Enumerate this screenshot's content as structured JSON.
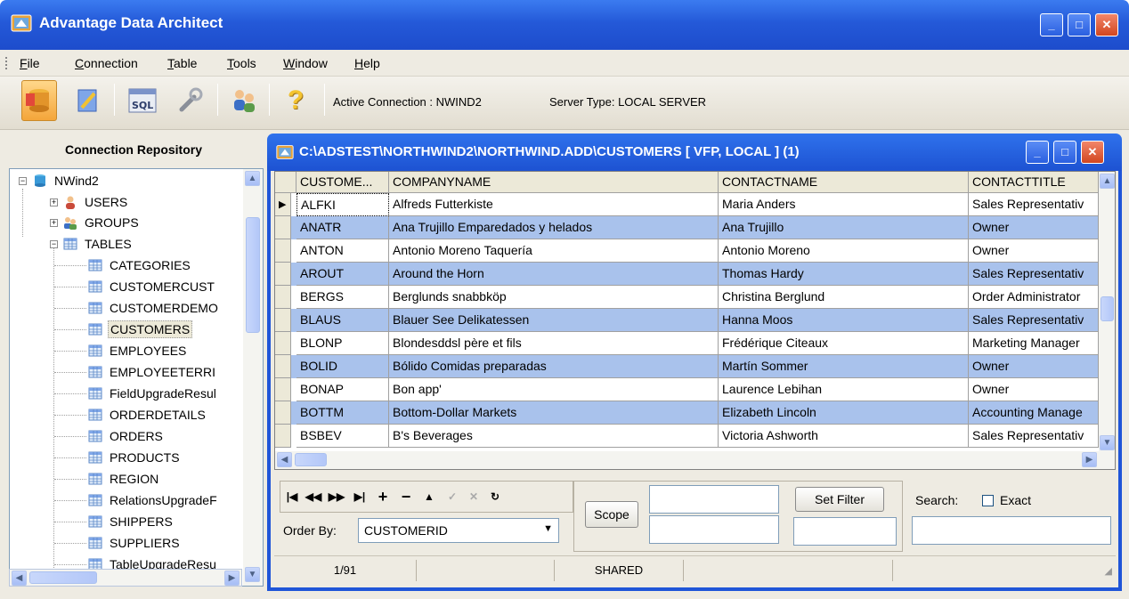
{
  "window": {
    "title": "Advantage Data Architect",
    "minimize": "_",
    "maximize": "□",
    "close": "✕"
  },
  "menu": [
    "File",
    "Connection",
    "Table",
    "Tools",
    "Window",
    "Help"
  ],
  "toolbar": {
    "active_connection": "Active Connection : NWIND2",
    "server_type": "Server Type: LOCAL SERVER",
    "help_glyph": "?"
  },
  "repository": {
    "title": "Connection Repository",
    "root": "NWind2",
    "groups": [
      "USERS",
      "GROUPS",
      "TABLES"
    ],
    "tables": [
      "CATEGORIES",
      "CUSTOMERCUST",
      "CUSTOMERDEMO",
      "CUSTOMERS",
      "EMPLOYEES",
      "EMPLOYEETERRI",
      "FieldUpgradeResul",
      "ORDERDETAILS",
      "ORDERS",
      "PRODUCTS",
      "REGION",
      "RelationsUpgradeF",
      "SHIPPERS",
      "SUPPLIERS",
      "TableUpgradeResu"
    ]
  },
  "child": {
    "title": "C:\\ADSTEST\\NORTHWIND2\\NORTHWIND.ADD\\CUSTOMERS [ VFP, LOCAL ] (1)"
  },
  "grid": {
    "columns": [
      "CUSTOME...",
      "COMPANYNAME",
      "CONTACTNAME",
      "CONTACTTITLE"
    ],
    "rows": [
      [
        "ALFKI",
        "Alfreds Futterkiste",
        "Maria Anders",
        "Sales Representativ"
      ],
      [
        "ANATR",
        "Ana Trujillo Emparedados y helados",
        "Ana Trujillo",
        "Owner"
      ],
      [
        "ANTON",
        "Antonio Moreno Taquería",
        "Antonio Moreno",
        "Owner"
      ],
      [
        "AROUT",
        "Around the Horn",
        "Thomas Hardy",
        "Sales Representativ"
      ],
      [
        "BERGS",
        "Berglunds snabbköp",
        "Christina Berglund",
        "Order Administrator"
      ],
      [
        "BLAUS",
        "Blauer See Delikatessen",
        "Hanna Moos",
        "Sales Representativ"
      ],
      [
        "BLONP",
        "Blondesddsl père et fils",
        "Frédérique Citeaux",
        "Marketing Manager"
      ],
      [
        "BOLID",
        "Bólido Comidas preparadas",
        "Martín Sommer",
        "Owner"
      ],
      [
        "BONAP",
        "Bon app'",
        "Laurence Lebihan",
        "Owner"
      ],
      [
        "BOTTM",
        "Bottom-Dollar Markets",
        "Elizabeth Lincoln",
        "Accounting Manage"
      ],
      [
        "BSBEV",
        "B's Beverages",
        "Victoria Ashworth",
        "Sales Representativ"
      ]
    ]
  },
  "nav": {
    "scope": "Scope",
    "set_filter": "Set Filter",
    "search_label": "Search:",
    "exact_label": "Exact",
    "order_by_label": "Order By:",
    "order_by_value": "CUSTOMERID"
  },
  "status": {
    "record": "1/91",
    "mode": "SHARED"
  }
}
